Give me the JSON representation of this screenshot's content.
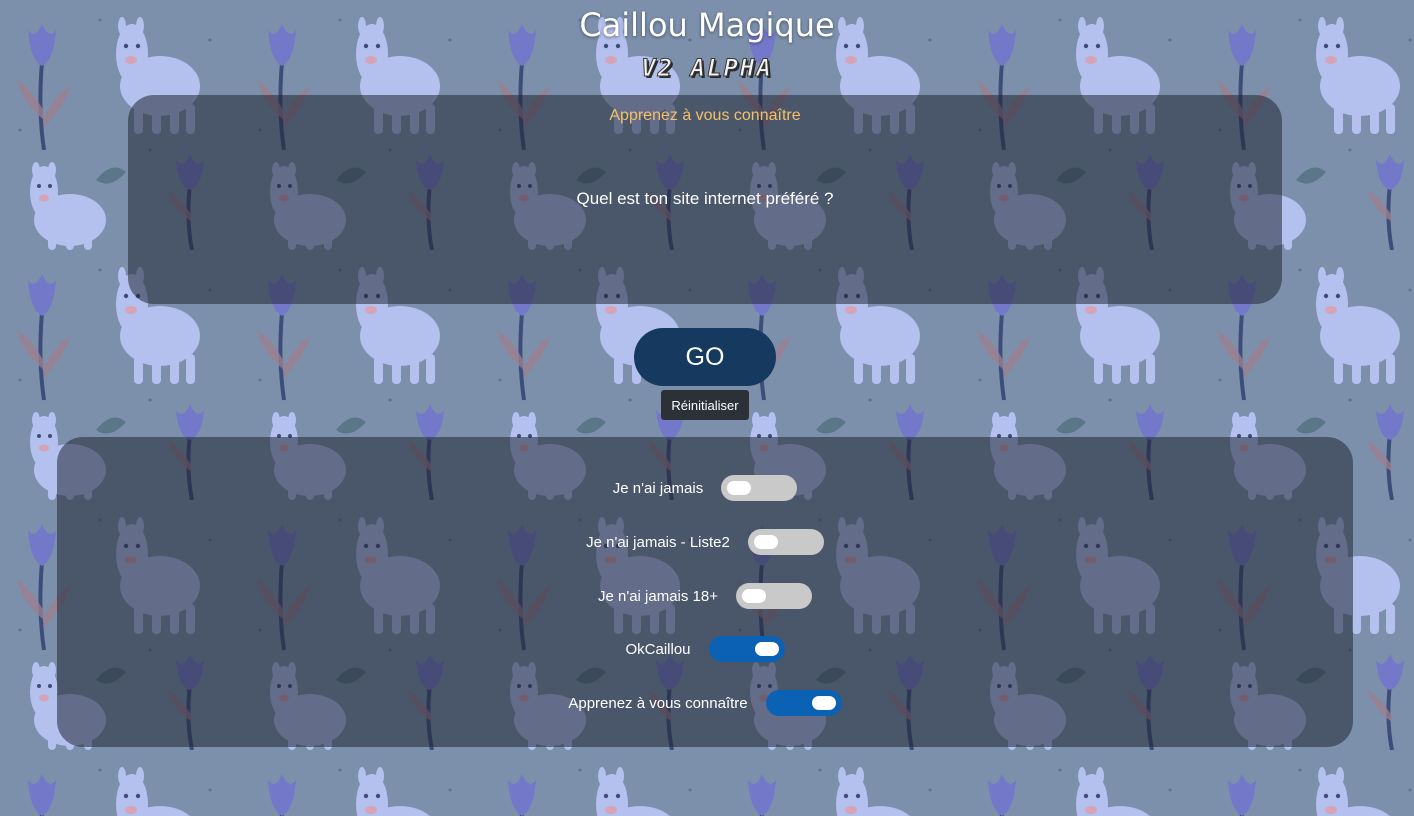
{
  "header": {
    "title": "Caillou Magique",
    "subtitle": "V2 ALPHA"
  },
  "card": {
    "mode_title": "Apprenez à vous connaître",
    "question": "Quel est ton site internet préféré ?"
  },
  "actions": {
    "go_label": "GO",
    "reset_label": "Réinitialiser"
  },
  "settings": {
    "toggles": [
      {
        "label": "Je n'ai jamais",
        "enabled": false
      },
      {
        "label": "Je n'ai jamais - Liste2",
        "enabled": false
      },
      {
        "label": "Je n'ai jamais 18+",
        "enabled": false
      },
      {
        "label": "OkCaillou",
        "enabled": true
      },
      {
        "label": "Apprenez à vous connaître",
        "enabled": true
      }
    ]
  },
  "colors": {
    "accent_gold": "#f5c065",
    "go_button": "#163a5f",
    "toggle_on": "#0b62b5",
    "toggle_off": "#c9c9c9",
    "background": "#7c90ac"
  },
  "background_motif": [
    "alpaca",
    "purple-tulip",
    "leaf"
  ]
}
